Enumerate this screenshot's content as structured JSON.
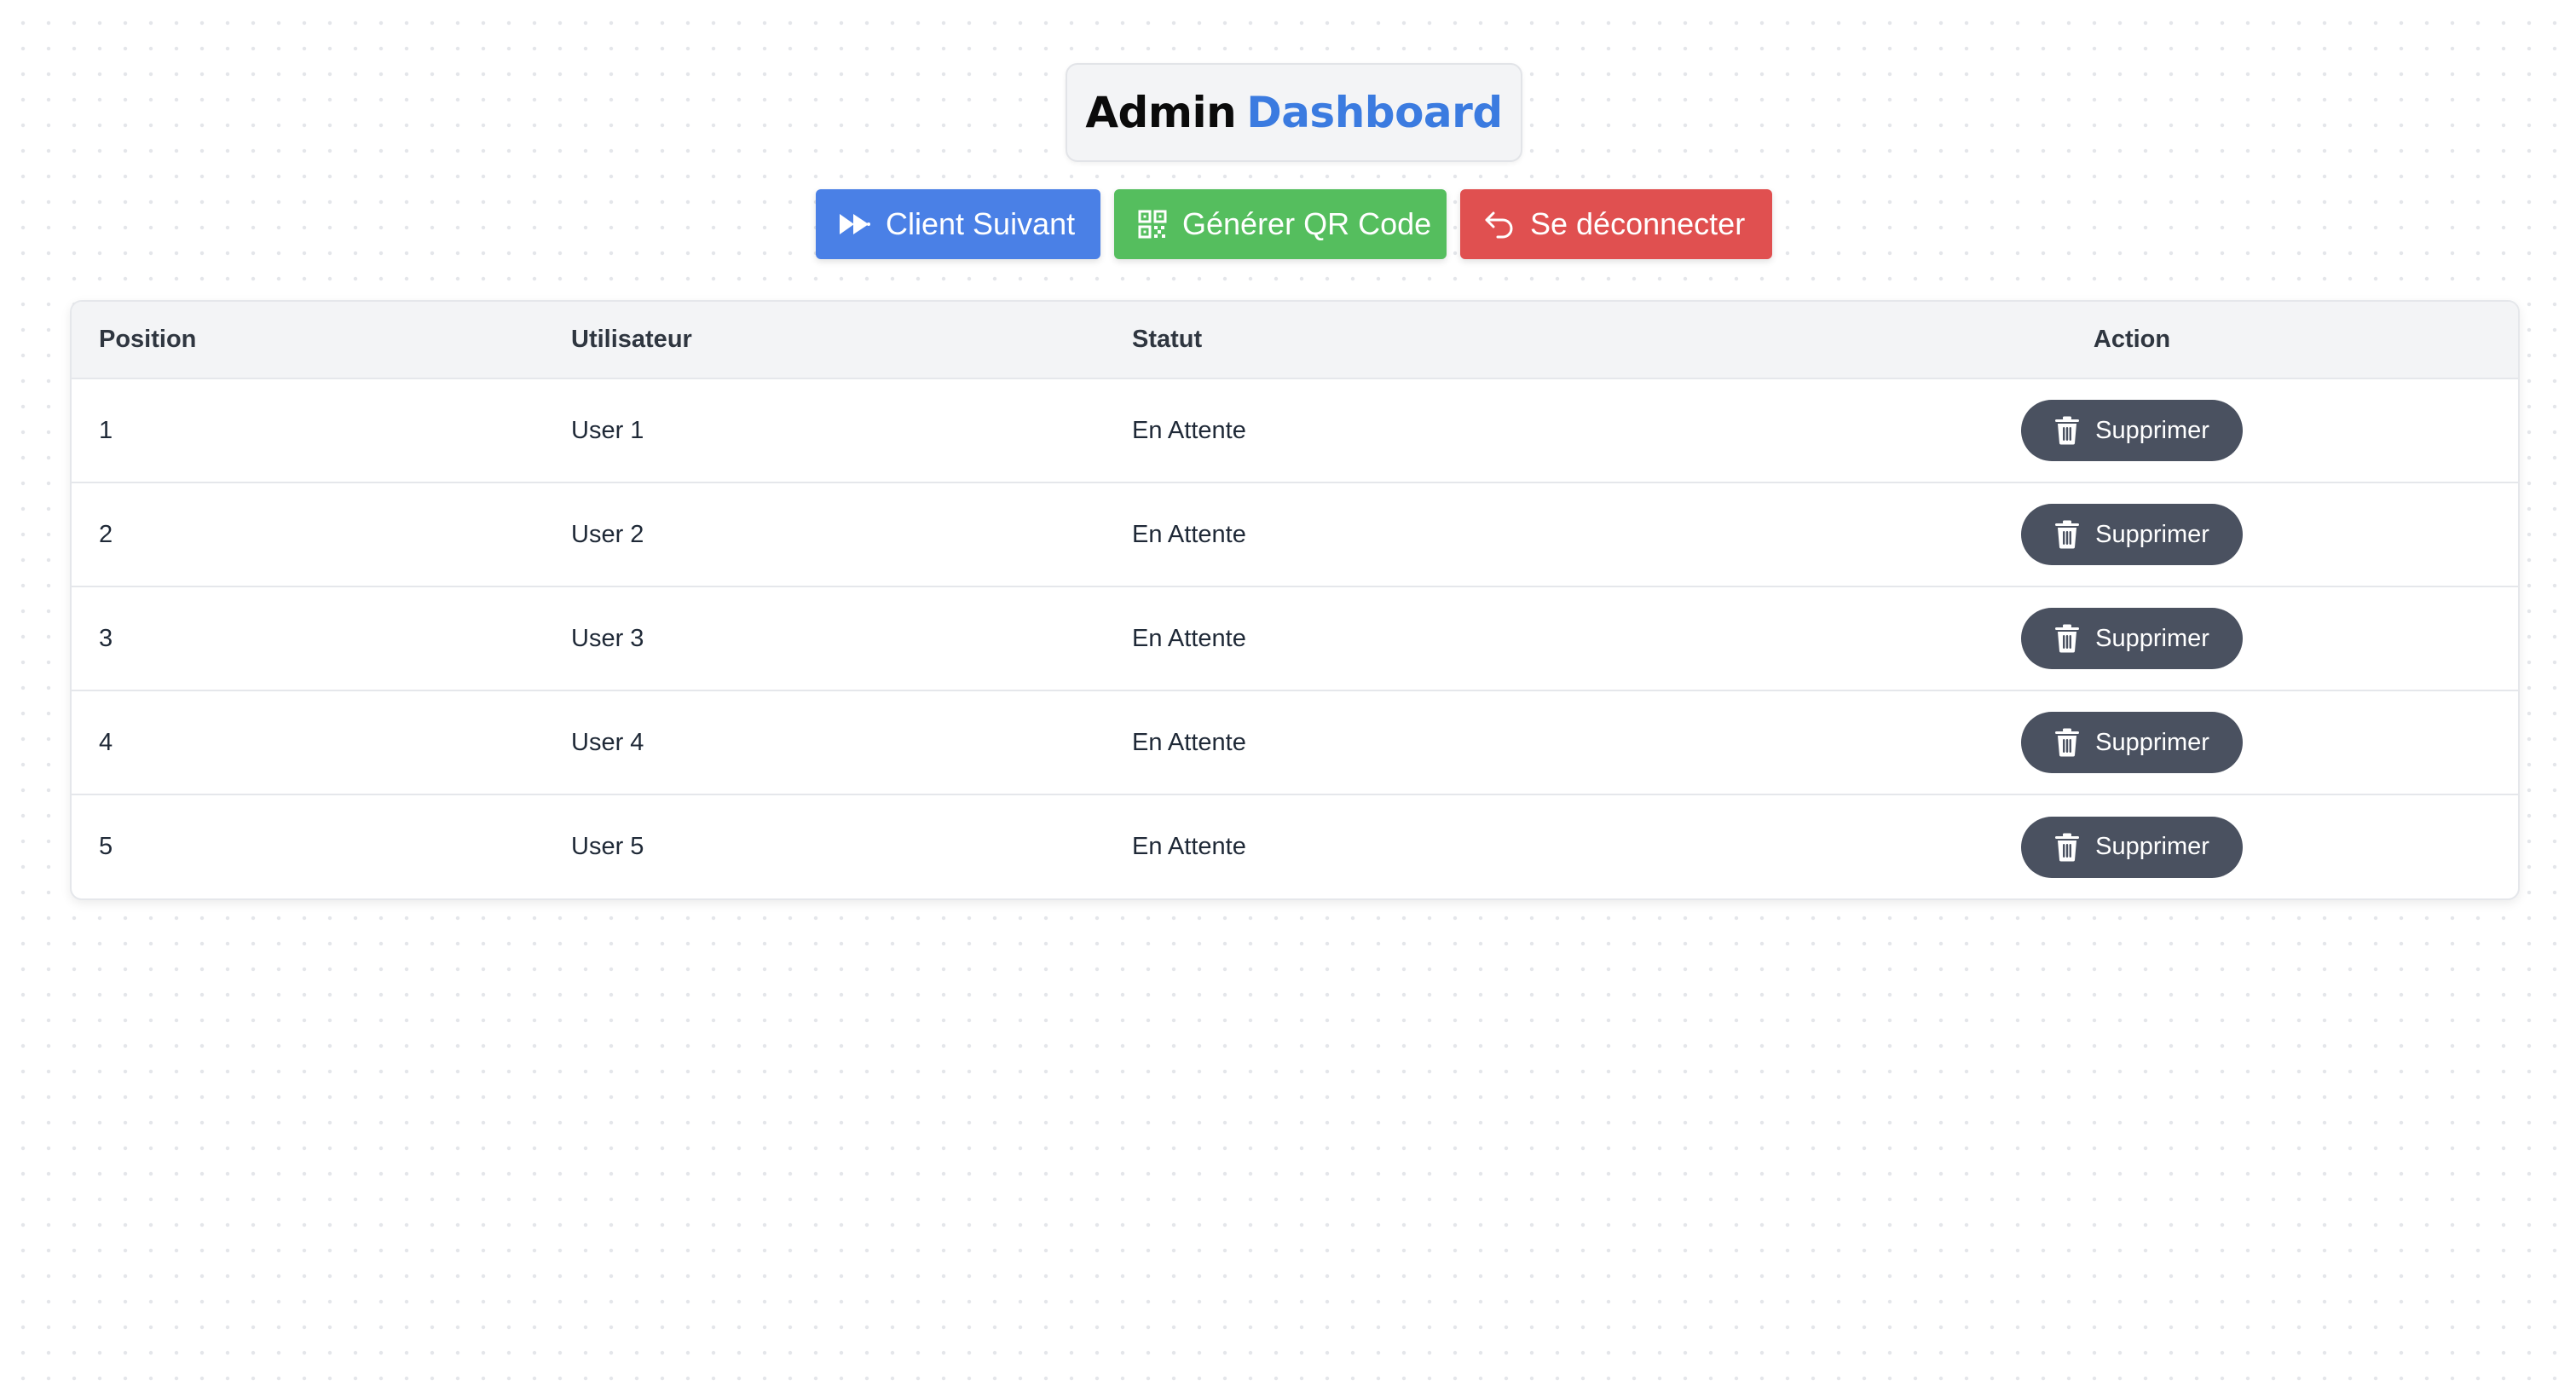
{
  "header": {
    "title_part1": "Admin",
    "title_part2": "Dashboard"
  },
  "toolbar": {
    "next_client_label": "Client Suivant",
    "generate_qr_label": "Générer QR Code",
    "logout_label": "Se déconnecter",
    "next_client_icon": "fast-forward-icon",
    "generate_qr_icon": "qr-code-icon",
    "logout_icon": "logout-arrow-icon"
  },
  "table": {
    "headers": {
      "position": "Position",
      "user": "Utilisateur",
      "status": "Statut",
      "action": "Action"
    },
    "delete_label": "Supprimer",
    "delete_icon": "trash-icon",
    "rows": [
      {
        "position": "1",
        "user": "User 1",
        "status": "En Attente"
      },
      {
        "position": "2",
        "user": "User 2",
        "status": "En Attente"
      },
      {
        "position": "3",
        "user": "User 3",
        "status": "En Attente"
      },
      {
        "position": "4",
        "user": "User 4",
        "status": "En Attente"
      },
      {
        "position": "5",
        "user": "User 5",
        "status": "En Attente"
      }
    ]
  },
  "colors": {
    "accent_blue": "#4a80e6",
    "title_blue": "#3b7be0",
    "success_green": "#55be5e",
    "danger_red": "#e05050",
    "delete_gray": "#4a5160"
  }
}
